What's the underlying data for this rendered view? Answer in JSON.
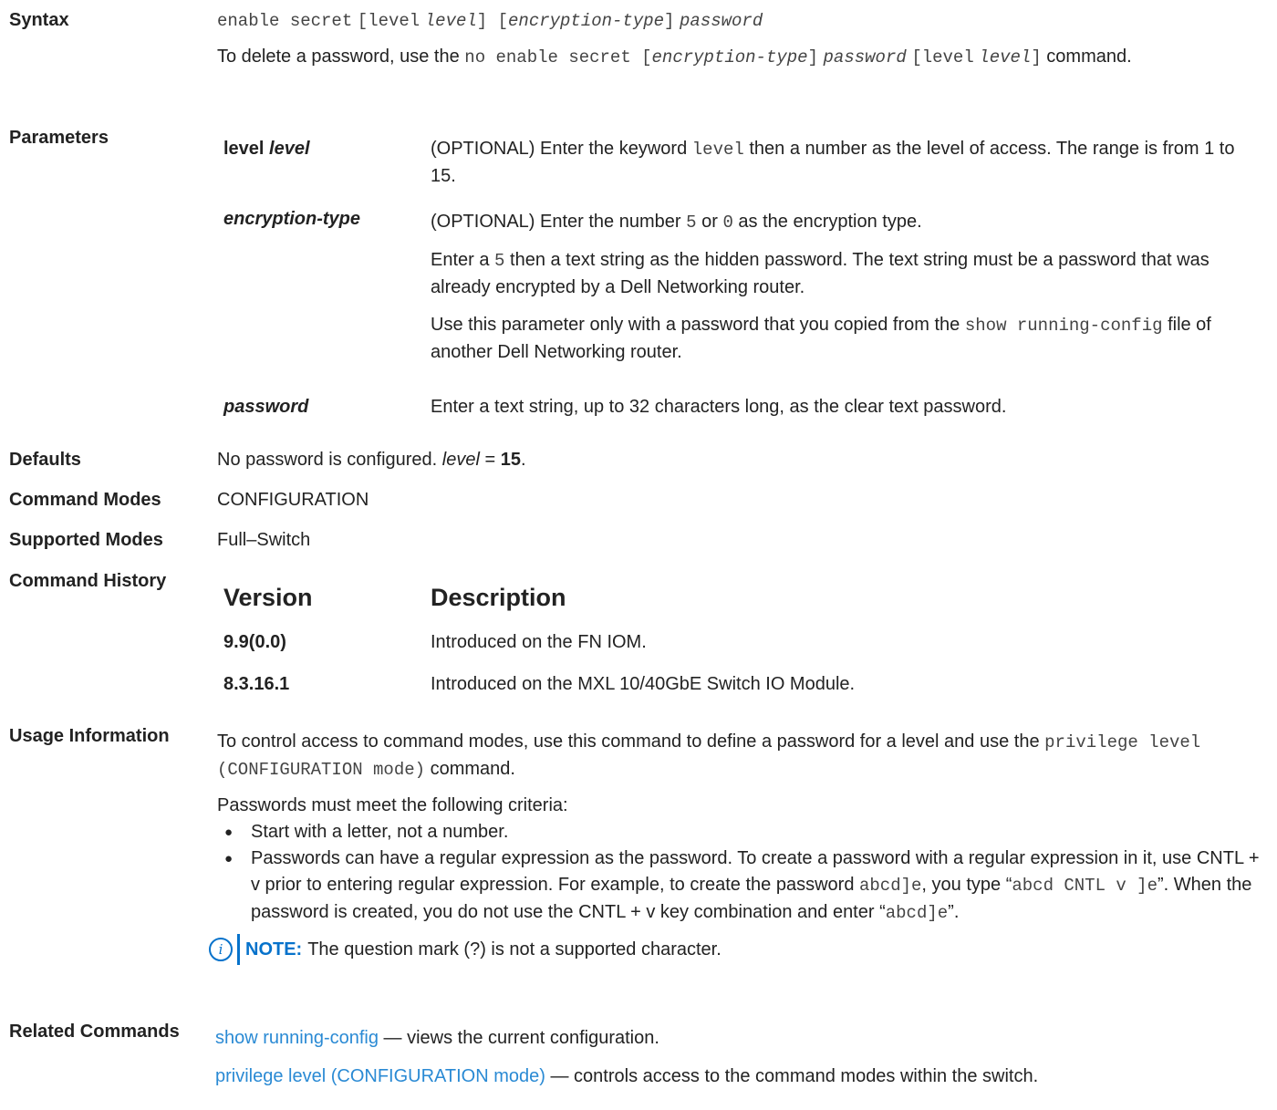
{
  "labels": {
    "syntax": "Syntax",
    "parameters": "Parameters",
    "defaults": "Defaults",
    "command_modes": "Command Modes",
    "supported_modes": "Supported Modes",
    "command_history": "Command History",
    "usage_information": "Usage Information",
    "related_commands": "Related Commands"
  },
  "syntax": {
    "cmd": "enable secret",
    "open1": "[level",
    "level_arg": "level",
    "close_open": "] [",
    "enc_arg": "encryption-type",
    "close2": "]",
    "pw_arg": "password",
    "delete_prefix": "To delete a password, use the",
    "delete_cmd": "no enable secret [",
    "delete_enc": "encryption-type",
    "delete_mid": "]",
    "delete_pw": "password",
    "delete_level": "[level",
    "delete_level_arg": "level",
    "delete_close": "]",
    "delete_suffix": "command."
  },
  "parameters": [
    {
      "term_a": "level ",
      "term_b": "level",
      "desc_1": "(OPTIONAL) Enter the keyword",
      "desc_code": "level",
      "desc_2": "then a number as the level of access. The range is from 1 to 15."
    },
    {
      "term": "encryption-type",
      "p1_a": "(OPTIONAL) Enter the number",
      "p1_code1": "5",
      "p1_b": "or",
      "p1_code2": "0",
      "p1_c": "as the encryption type.",
      "p2_a": "Enter a",
      "p2_code": "5",
      "p2_b": "then a text string as the hidden password. The text string must be a password that was already encrypted by a Dell Networking router.",
      "p3_a": "Use this parameter only with a password that you copied from the",
      "p3_code": "show running-config",
      "p3_b": "file of another Dell Networking router."
    },
    {
      "term": "password",
      "desc": "Enter a text string, up to 32 characters long, as the clear text password."
    }
  ],
  "defaults": {
    "text": "No password is configured.",
    "level_word": "level",
    "equals": " = ",
    "value": "15",
    "end": "."
  },
  "command_modes": "CONFIGURATION",
  "supported_modes": "Full–Switch",
  "history": {
    "col_version": "Version",
    "col_description": "Description",
    "rows": [
      {
        "version": "9.9(0.0)",
        "description": "Introduced on the FN IOM."
      },
      {
        "version": "8.3.16.1",
        "description": "Introduced on the MXL 10/40GbE Switch IO Module."
      }
    ]
  },
  "usage": {
    "p1_a": "To control access to command modes, use this command to define a password for a level and use the",
    "p1_code": "privilege level (CONFIGURATION mode)",
    "p1_b": "command.",
    "criteria_intro": "Passwords must meet the following criteria:",
    "bullet1": "Start with a letter, not a number.",
    "b2_a": "Passwords can have a regular expression as the password. To create a password with a regular expression in it, use CNTL + v prior to entering regular expression. For example, to create the password",
    "b2_code1": "abcd]e",
    "b2_b": ", you type “",
    "b2_code2": "abcd CNTL v ]e",
    "b2_c": "”. When the password is created, you do not use the CNTL + v key combination and enter “",
    "b2_code3": "abcd]e",
    "b2_d": "”.",
    "note_label": "NOTE:",
    "note_text": "The question mark (?) is not a supported character."
  },
  "related": [
    {
      "link": "show running-config",
      "desc": " — views the current configuration."
    },
    {
      "link": "privilege level (CONFIGURATION mode)",
      "desc": " — controls access to the command modes within the switch."
    }
  ],
  "colors": {
    "link": "#2a8ad4",
    "note_accent": "#0672cb",
    "text": "#222222"
  }
}
